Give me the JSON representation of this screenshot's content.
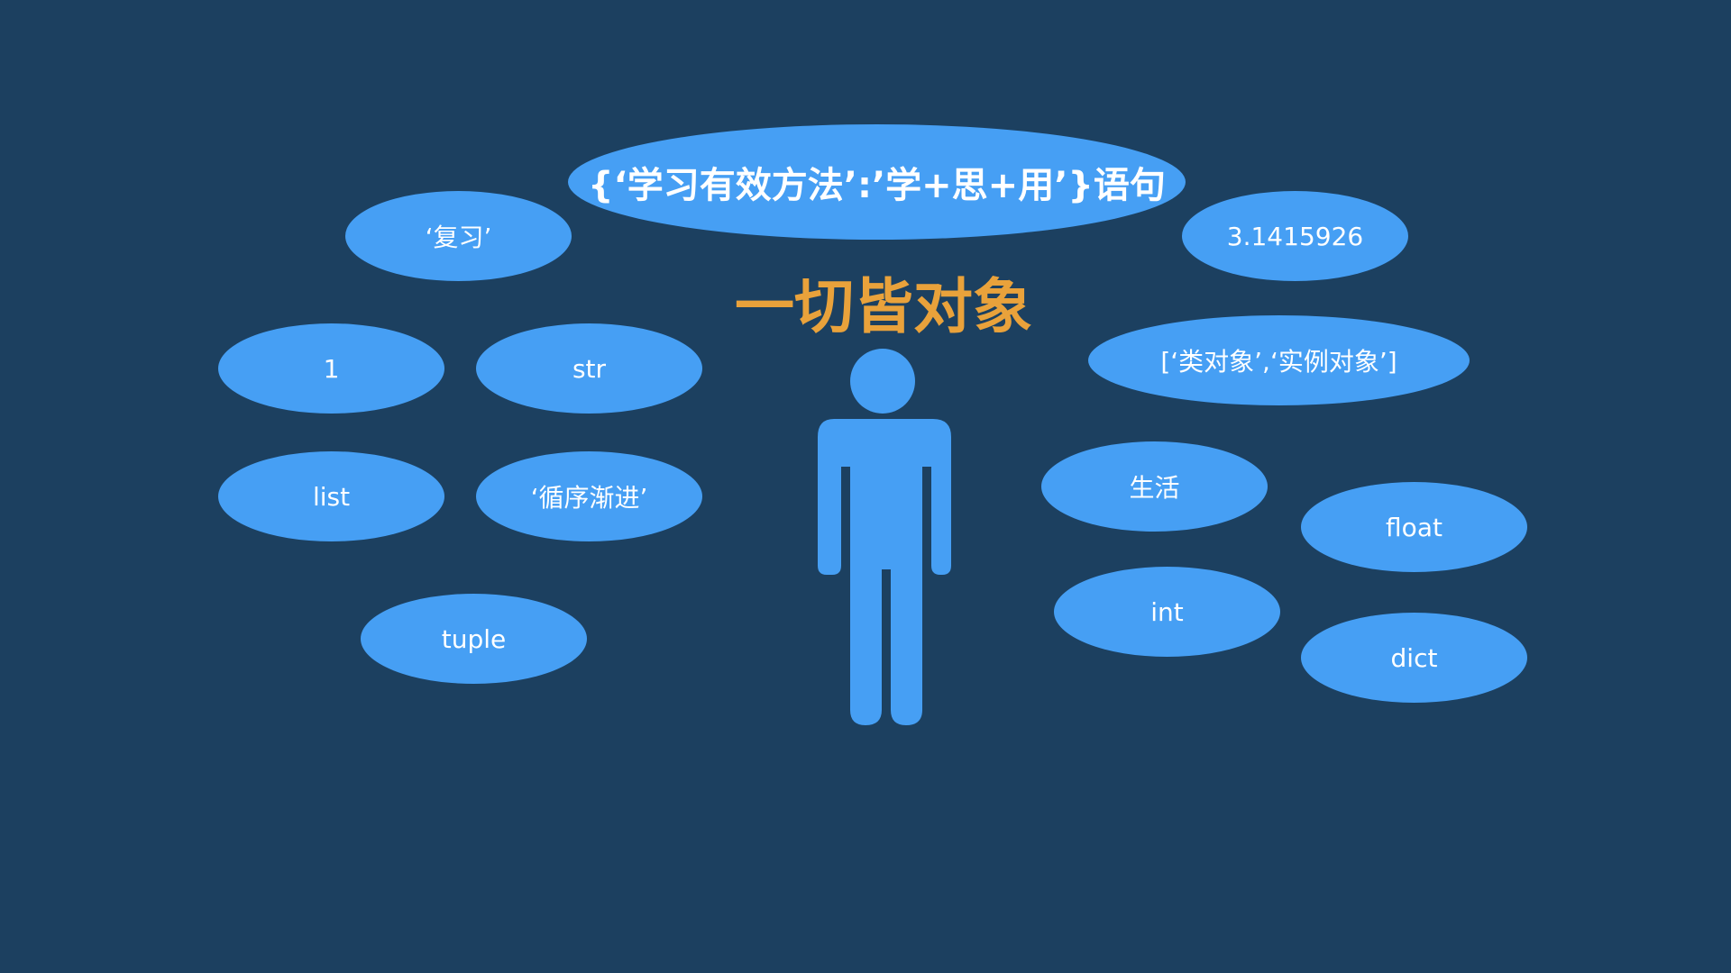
{
  "title": "一切皆对象",
  "colors": {
    "background": "#1c4060",
    "bubble": "#469ff4",
    "title": "#e9a23b",
    "bubble_text": "#ffffff"
  },
  "center_figure": {
    "icon": "person-icon"
  },
  "bubbles": {
    "statement": "{‘学习有效方法’:’学+思+用’}语句",
    "review": "‘复习’",
    "pi": "3.1415926",
    "one": "1",
    "str": "str",
    "class_list": "[‘类对象’,‘实例对象’]",
    "list": "list",
    "gradual": "‘循序渐进’",
    "life": "生活",
    "float": "float",
    "tuple": "tuple",
    "int": "int",
    "dict": "dict"
  }
}
